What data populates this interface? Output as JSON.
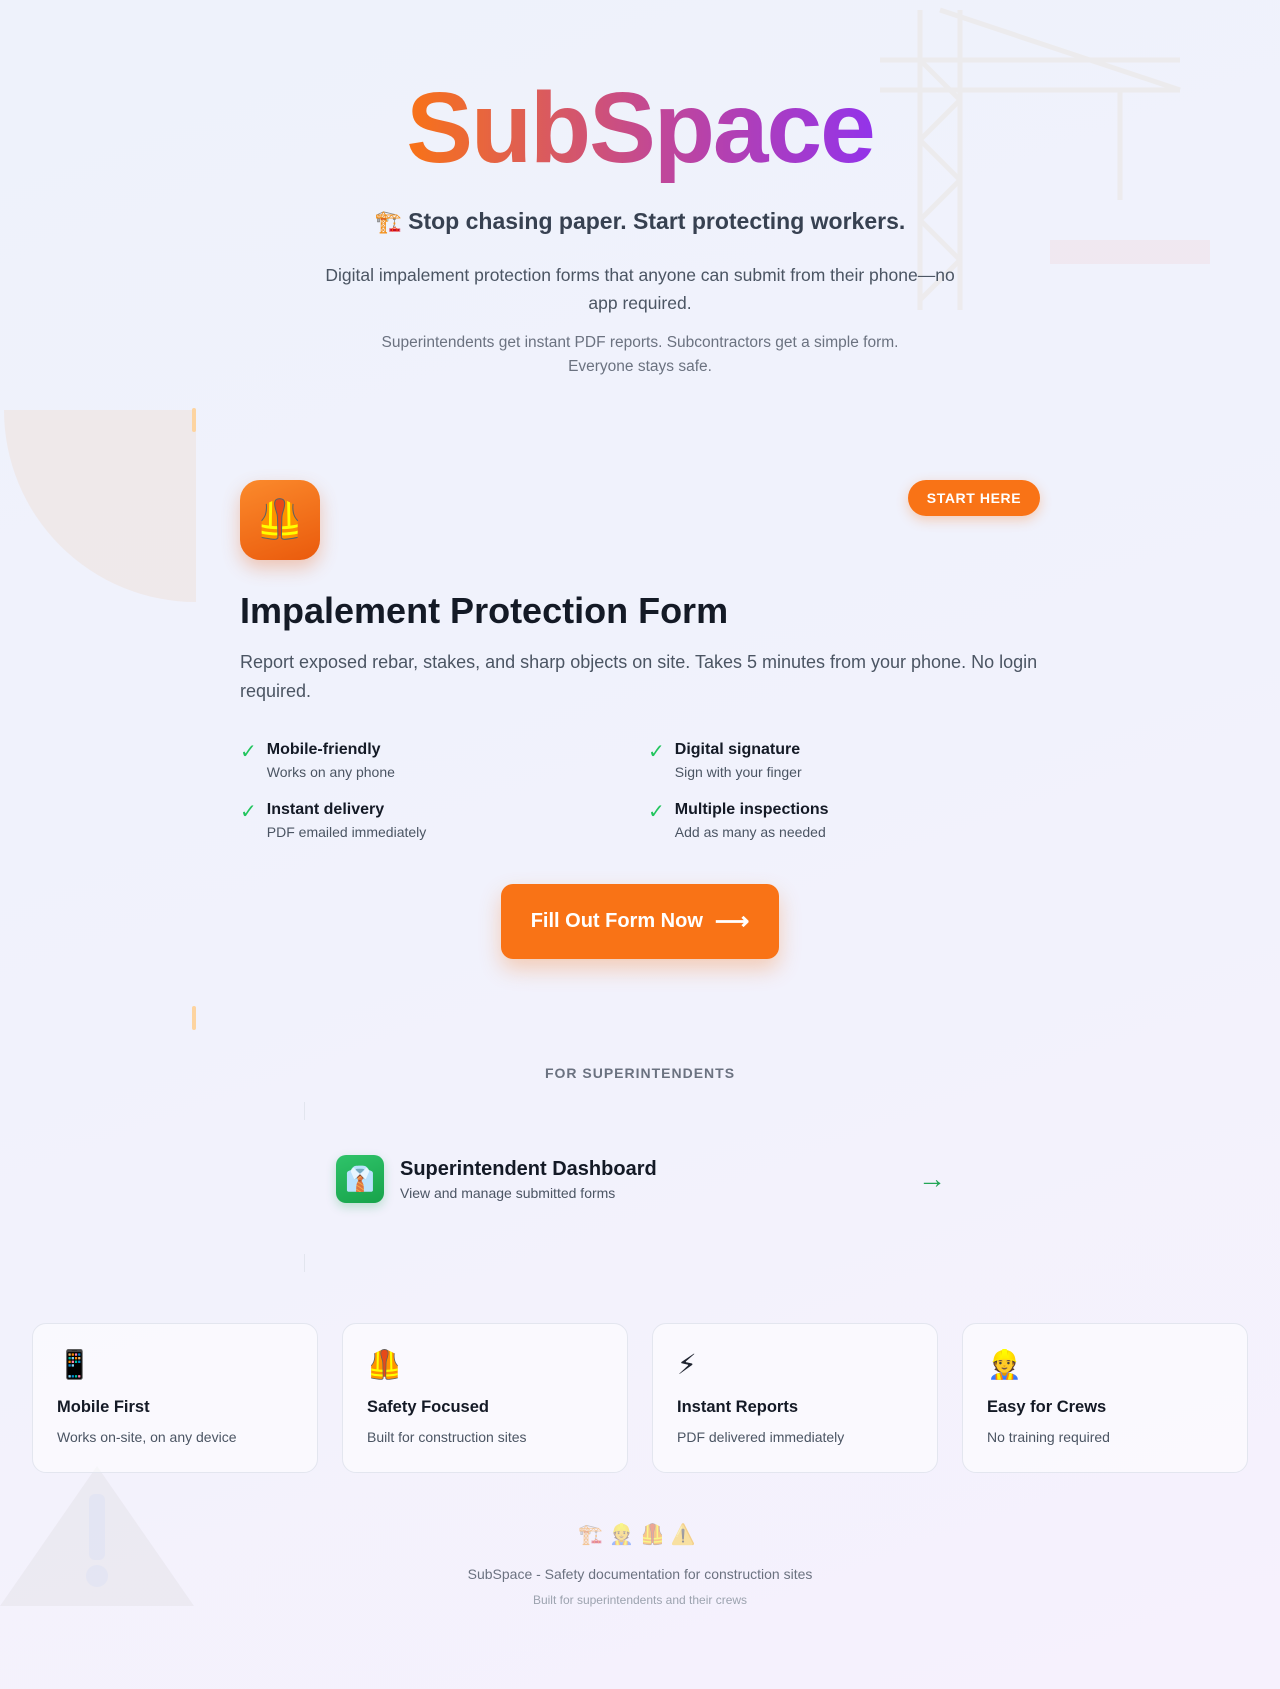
{
  "hero": {
    "brand": "SubSpace",
    "tagline_icon": "🏗️",
    "tagline": "Stop chasing paper. Start protecting workers.",
    "lead": "Digital impalement protection forms that anyone can submit from their phone—no app required.",
    "sublead": "Superintendents get instant PDF reports. Subcontractors get a simple form. Everyone stays safe."
  },
  "form_card": {
    "icon": "🦺",
    "badge": "START HERE",
    "title": "Impalement Protection Form",
    "description": "Report exposed rebar, stakes, and sharp objects on site. Takes 5 minutes from your phone. No login required.",
    "features": [
      {
        "title": "Mobile-friendly",
        "sub": "Works on any phone"
      },
      {
        "title": "Digital signature",
        "sub": "Sign with your finger"
      },
      {
        "title": "Instant delivery",
        "sub": "PDF emailed immediately"
      },
      {
        "title": "Multiple inspections",
        "sub": "Add as many as needed"
      }
    ],
    "check_glyph": "✓",
    "cta_label": "Fill Out Form Now",
    "cta_arrow": "⟶"
  },
  "superintendents": {
    "section_label": "FOR SUPERINTENDENTS",
    "dashboard_icon": "👔",
    "dashboard_title": "Superintendent Dashboard",
    "dashboard_sub": "View and manage submitted forms",
    "arrow": "→"
  },
  "cards": [
    {
      "icon": "📱",
      "title": "Mobile First",
      "sub": "Works on-site, on any device"
    },
    {
      "icon": "🦺",
      "title": "Safety Focused",
      "sub": "Built for construction sites"
    },
    {
      "icon": "⚡",
      "title": "Instant Reports",
      "sub": "PDF delivered immediately"
    },
    {
      "icon": "👷",
      "title": "Easy for Crews",
      "sub": "No training required"
    }
  ],
  "footer": {
    "emojis": "🏗️👷🦺⚠️",
    "main": "SubSpace - Safety documentation for construction sites",
    "sub": "Built for superintendents and their crews"
  },
  "colors": {
    "brand_orange": "#f97316",
    "brand_purple": "#9333ea",
    "success_green": "#22c55e",
    "text_dark": "#141a26"
  }
}
